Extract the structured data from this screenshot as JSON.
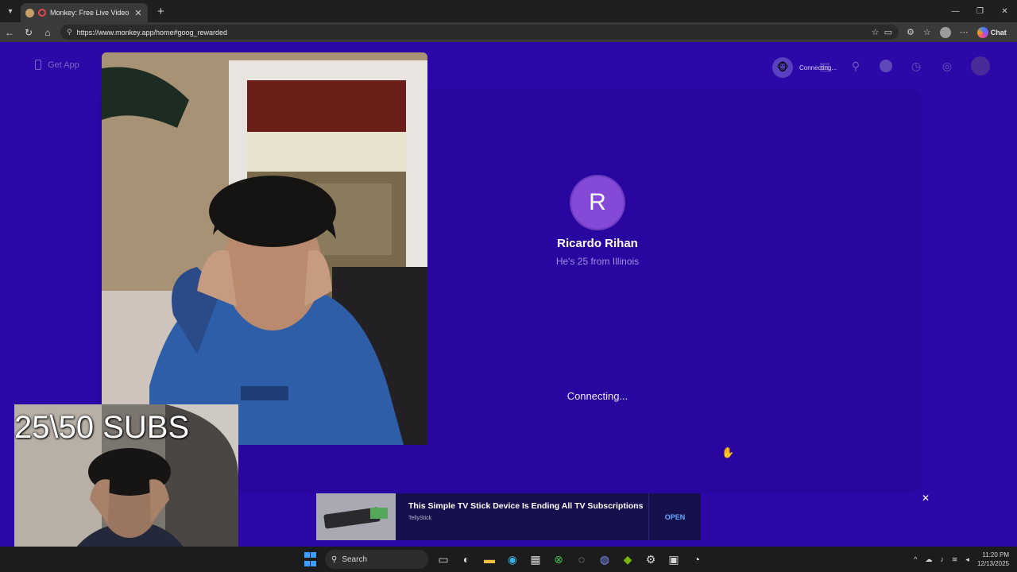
{
  "browser": {
    "tab_title": "Monkey: Free Live Video Chat",
    "url": "https://www.monkey.app/home#goog_rewarded",
    "chat_label": "Chat"
  },
  "page": {
    "get_app": "Get App",
    "status_chip": "Connecting...",
    "peer": {
      "initial": "R",
      "name": "Ricardo Rihan",
      "description": "He's 25 from Illinois"
    },
    "connecting_text": "Connecting..."
  },
  "ad": {
    "title": "This Simple TV Stick Device Is Ending All TV Subscriptions",
    "sponsor": "TellyStick",
    "cta": "OPEN"
  },
  "overlay": {
    "subs_text": "25\\50 SUBS"
  },
  "taskbar": {
    "search_label": "Search",
    "time": "11:20 PM",
    "date": "12/13/2025"
  },
  "colors": {
    "page_bg": "#2d08a8",
    "avatar": "#8449d6",
    "cta": "#6aa9ff"
  }
}
